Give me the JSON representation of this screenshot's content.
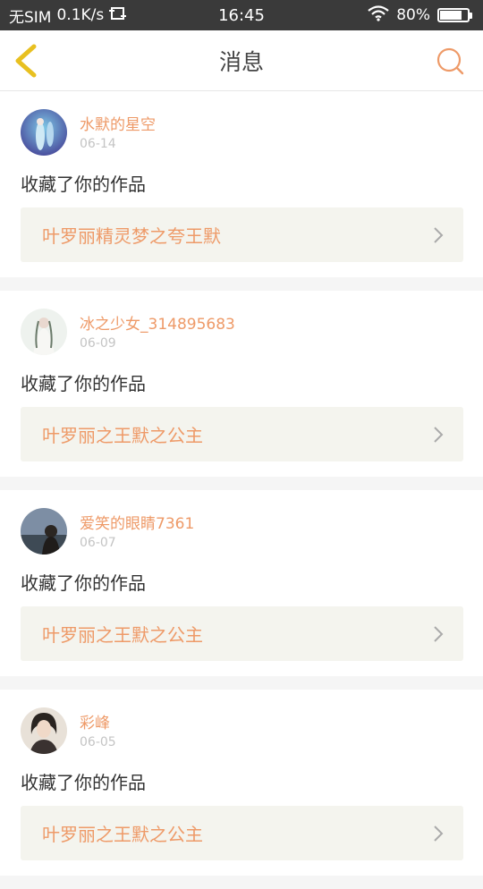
{
  "status_bar": {
    "carrier": "无SIM",
    "speed": "0.1K/s",
    "time": "16:45",
    "battery": "80%",
    "battery_level": 0.8
  },
  "header": {
    "title": "消息",
    "back_icon": "chevron-left-icon",
    "search_icon": "search-icon"
  },
  "colors": {
    "accent": "#ee9a68",
    "back_icon": "#e8c020",
    "link_bg": "#f4f4ee"
  },
  "messages": [
    {
      "username": "水默的星空",
      "date": "06-14",
      "action": "收藏了你的作品",
      "work_title": "叶罗丽精灵梦之夸王默"
    },
    {
      "username": "冰之少女_314895683",
      "date": "06-09",
      "action": "收藏了你的作品",
      "work_title": "叶罗丽之王默之公主"
    },
    {
      "username": "爱笑的眼睛7361",
      "date": "06-07",
      "action": "收藏了你的作品",
      "work_title": "叶罗丽之王默之公主"
    },
    {
      "username": "彩峰",
      "date": "06-05",
      "action": "收藏了你的作品",
      "work_title": "叶罗丽之王默之公主"
    }
  ]
}
